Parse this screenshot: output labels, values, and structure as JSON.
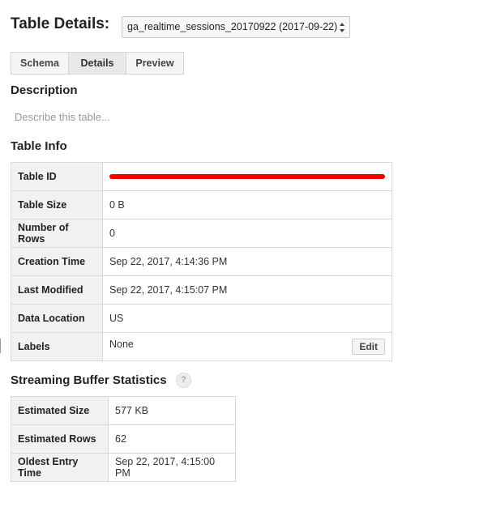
{
  "header": {
    "title": "Table Details:",
    "table_select": {
      "selected": "ga_realtime_sessions_20170922 (2017-09-22)",
      "icon": "select-arrows-icon"
    }
  },
  "tabs": [
    {
      "label": "Schema",
      "active": false
    },
    {
      "label": "Details",
      "active": true
    },
    {
      "label": "Preview",
      "active": false
    }
  ],
  "description": {
    "heading": "Description",
    "placeholder": "Describe this table..."
  },
  "table_info": {
    "heading": "Table Info",
    "rows": [
      {
        "label": "Table ID",
        "value": "",
        "redacted": true
      },
      {
        "label": "Table Size",
        "value": "0 B"
      },
      {
        "label": "Number of Rows",
        "value": "0"
      },
      {
        "label": "Creation Time",
        "value": "Sep 22, 2017, 4:14:36 PM"
      },
      {
        "label": "Last Modified",
        "value": "Sep 22, 2017, 4:15:07 PM"
      },
      {
        "label": "Data Location",
        "value": "US"
      },
      {
        "label": "Labels",
        "value": "None",
        "action": "Edit"
      }
    ]
  },
  "streaming_buffer": {
    "heading": "Streaming Buffer Statistics",
    "help_icon": "?",
    "rows": [
      {
        "label": "Estimated Size",
        "value": "577 KB"
      },
      {
        "label": "Estimated Rows",
        "value": "62"
      },
      {
        "label": "Oldest Entry Time",
        "value": "Sep 22, 2017, 4:15:00 PM"
      }
    ]
  },
  "colors": {
    "redaction": "#f00000",
    "key_cell_bg": "#f1f1f1",
    "border": "#d9d9d9"
  }
}
